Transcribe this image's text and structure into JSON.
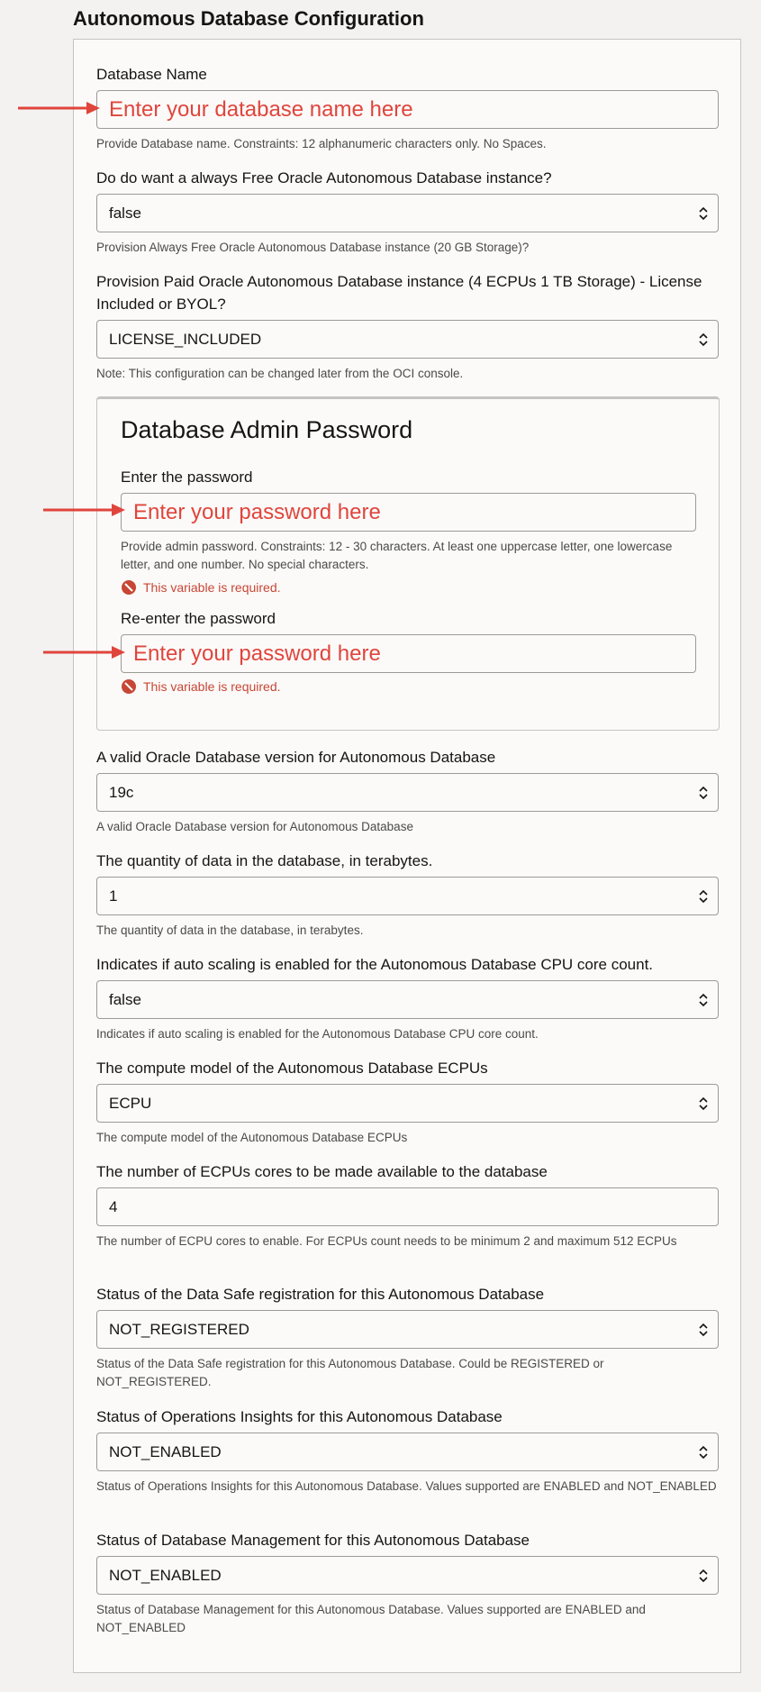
{
  "page": {
    "title": "Autonomous Database Configuration"
  },
  "db_name": {
    "label": "Database Name",
    "placeholder": "Enter your database name here",
    "help": "Provide Database name. Constraints: 12 alphanumeric characters only. No Spaces."
  },
  "free_tier": {
    "label": "Do do want a always Free Oracle Autonomous Database instance?",
    "value": "false",
    "help": "Provision Always Free Oracle Autonomous Database instance (20 GB Storage)?"
  },
  "license": {
    "label": "Provision Paid Oracle Autonomous Database instance (4 ECPUs 1 TB Storage) - License Included or BYOL?",
    "value": "LICENSE_INCLUDED",
    "help": "Note: This configuration can be changed later from the OCI console."
  },
  "password_section": {
    "title": "Database Admin Password",
    "password": {
      "label": "Enter the password",
      "placeholder": "Enter your password here",
      "help": "Provide admin password. Constraints: 12 - 30 characters. At least one uppercase letter, one lowercase letter, and one number. No special characters.",
      "error": "This variable is required."
    },
    "confirm": {
      "label": "Re-enter the password",
      "placeholder": "Enter your password here",
      "error": "This variable is required."
    }
  },
  "db_version": {
    "label": "A valid Oracle Database version for Autonomous Database",
    "value": "19c",
    "help": "A valid Oracle Database version for Autonomous Database"
  },
  "data_size": {
    "label": "The quantity of data in the database, in terabytes.",
    "value": "1",
    "help": "The quantity of data in the database, in terabytes."
  },
  "auto_scaling": {
    "label": "Indicates if auto scaling is enabled for the Autonomous Database CPU core count.",
    "value": "false",
    "help": "Indicates if auto scaling is enabled for the Autonomous Database CPU core count."
  },
  "compute_model": {
    "label": "The compute model of the Autonomous Database ECPUs",
    "value": "ECPU",
    "help": "The compute model of the Autonomous Database ECPUs"
  },
  "ecpu_count": {
    "label": "The number of ECPUs cores to be made available to the database",
    "value": "4",
    "help": "The number of ECPU cores to enable. For ECPUs count needs to be minimum 2 and maximum 512 ECPUs"
  },
  "data_safe": {
    "label": "Status of the Data Safe registration for this Autonomous Database",
    "value": "NOT_REGISTERED",
    "help": "Status of the Data Safe registration for this Autonomous Database. Could be REGISTERED or NOT_REGISTERED."
  },
  "ops_insights": {
    "label": "Status of Operations Insights for this Autonomous Database",
    "value": "NOT_ENABLED",
    "help": "Status of Operations Insights for this Autonomous Database. Values supported are ENABLED and NOT_ENABLED"
  },
  "db_management": {
    "label": "Status of Database Management for this Autonomous Database",
    "value": "NOT_ENABLED",
    "help": "Status of Database Management for this Autonomous Database. Values supported are ENABLED and NOT_ENABLED"
  },
  "icons": {
    "select": "chevron-up-down-icon",
    "error": "error-circle-icon",
    "annotation": "red-arrow-icon"
  },
  "colors": {
    "annotation_red": "#e0453c",
    "error_red": "#c74634",
    "border": "#9e9a95"
  }
}
